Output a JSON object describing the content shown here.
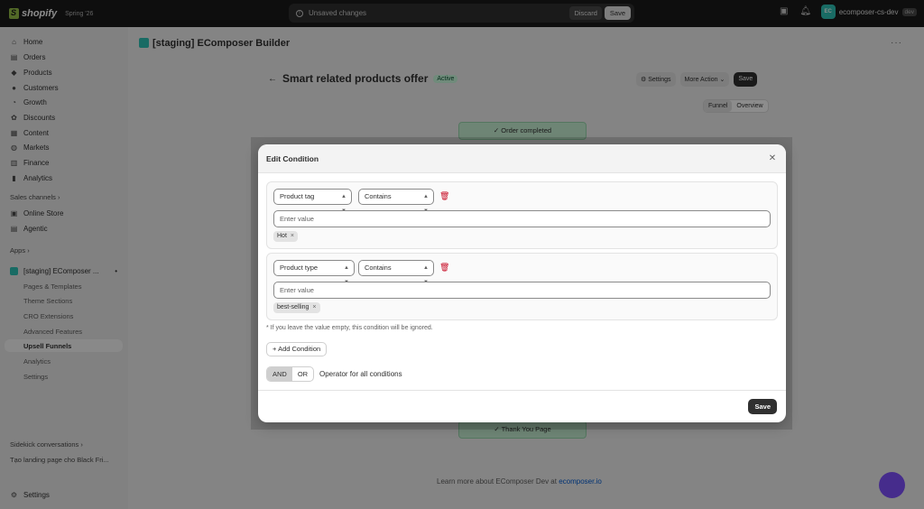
{
  "topbar": {
    "brand": "shopify",
    "version": "Spring '26",
    "unsaved_text": "Unsaved changes",
    "discard_label": "Discard",
    "save_label": "Save",
    "store_initials": "EC",
    "store_name": "ecomposer-cs-dev",
    "store_badge": "dev"
  },
  "sidebar": {
    "items": [
      {
        "label": "Home",
        "icon": "home-icon"
      },
      {
        "label": "Orders",
        "icon": "orders-icon"
      },
      {
        "label": "Products",
        "icon": "tag-icon"
      },
      {
        "label": "Customers",
        "icon": "person-icon"
      },
      {
        "label": "Growth",
        "icon": "growth-icon"
      },
      {
        "label": "Discounts",
        "icon": "discount-icon"
      },
      {
        "label": "Content",
        "icon": "content-icon"
      },
      {
        "label": "Markets",
        "icon": "globe-icon"
      },
      {
        "label": "Finance",
        "icon": "bank-icon"
      },
      {
        "label": "Analytics",
        "icon": "chart-icon"
      }
    ],
    "sales_channels_label": "Sales channels",
    "channels": [
      {
        "label": "Online Store"
      },
      {
        "label": "Agentic"
      }
    ],
    "apps_label": "Apps",
    "app_name": "[staging] EComposer ...",
    "app_subitems": [
      {
        "label": "Pages & Templates"
      },
      {
        "label": "Theme Sections"
      },
      {
        "label": "CRO Extensions"
      },
      {
        "label": "Advanced Features"
      },
      {
        "label": "Upsell Funnels"
      },
      {
        "label": "Analytics"
      },
      {
        "label": "Settings"
      }
    ],
    "sidekick_label": "Sidekick conversations",
    "conversation": "Tạo landing page cho Black Fri...",
    "settings_label": "Settings"
  },
  "main": {
    "title": "[staging] EComposer Builder",
    "page_title": "Smart related products offer",
    "status_badge": "Active",
    "settings_label": "Settings",
    "more_action_label": "More Action",
    "save_label": "Save",
    "view_tabs": [
      "Funnel",
      "Overview"
    ],
    "node_top": "✓ Order completed",
    "node_bottom": "✓ Thank You Page",
    "footer_text": "Learn more about EComposer Dev at",
    "footer_link": "ecomposer.io"
  },
  "modal": {
    "title": "Edit Condition",
    "conditions": [
      {
        "field": "Product tag",
        "operator": "Contains",
        "placeholder": "Enter value",
        "tags": [
          "Hot"
        ]
      },
      {
        "field": "Product type",
        "operator": "Contains",
        "placeholder": "Enter value",
        "tags": [
          "best-selling"
        ]
      }
    ],
    "hint": "* If you leave the value empty, this condition will be ignored.",
    "add_condition_label": "Add Condition",
    "operator_options": [
      "AND",
      "OR"
    ],
    "operator_selected": "AND",
    "operator_label": "Operator for all conditions",
    "save_label": "Save"
  }
}
